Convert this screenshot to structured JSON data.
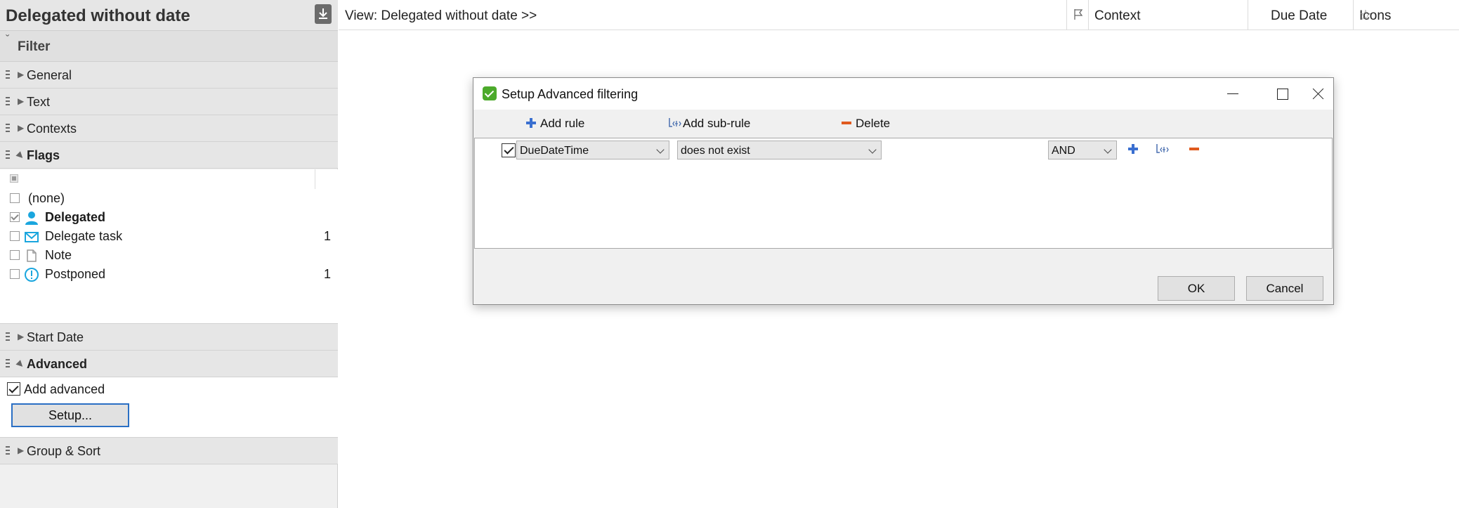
{
  "left_panel": {
    "title": "Delegated without date",
    "filter_label": "Filter",
    "sections": {
      "general": "General",
      "text": "Text",
      "contexts": "Contexts",
      "flags": "Flags",
      "start_date": "Start Date",
      "advanced": "Advanced",
      "group_sort": "Group & Sort"
    },
    "flags": [
      {
        "name": "(none)",
        "checked": false,
        "icon": "none",
        "count": ""
      },
      {
        "name": "Delegated",
        "checked": true,
        "icon": "person-icon",
        "count": ""
      },
      {
        "name": "Delegate task",
        "checked": false,
        "icon": "envelope-icon",
        "count": "1"
      },
      {
        "name": "Note",
        "checked": false,
        "icon": "note-icon",
        "count": ""
      },
      {
        "name": "Postponed",
        "checked": false,
        "icon": "exclamation-icon",
        "count": "1"
      }
    ],
    "advanced": {
      "add_label": "Add advanced",
      "add_checked": true,
      "setup_button": "Setup..."
    }
  },
  "list_header": {
    "view_label": "View: Delegated without date >>",
    "columns": {
      "context": "Context",
      "due_date": "Due Date",
      "icons": "Icons"
    }
  },
  "dialog": {
    "title": "Setup Advanced filtering",
    "toolbar": {
      "add_rule": "Add rule",
      "add_sub_rule": "Add sub-rule",
      "delete": "Delete"
    },
    "rules": [
      {
        "checked": true,
        "field": "DueDateTime",
        "operator": "does not exist",
        "value": "",
        "conjunction": "AND"
      }
    ],
    "ok": "OK",
    "cancel": "Cancel"
  },
  "colors": {
    "accent_blue": "#2a6fc4",
    "icon_cyan": "#1aa6de",
    "delete_orange": "#e05a1e",
    "dialog_icon_green": "#4caa2b"
  }
}
